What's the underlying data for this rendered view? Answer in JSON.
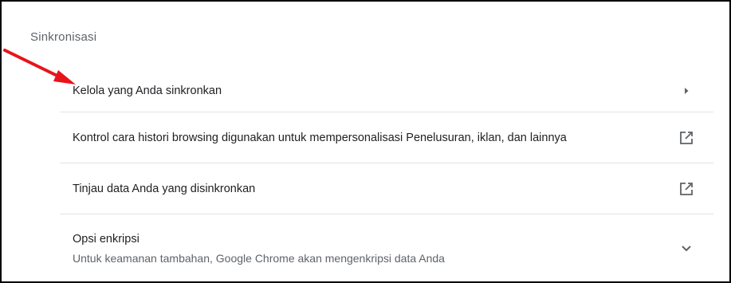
{
  "section": {
    "title": "Sinkronisasi"
  },
  "rows": [
    {
      "label": "Kelola yang Anda sinkronkan",
      "icon": "chevron-right-icon"
    },
    {
      "label": "Kontrol cara histori browsing digunakan untuk mempersonalisasi Penelusuran, iklan, dan lainnya",
      "icon": "open-external-icon"
    },
    {
      "label": "Tinjau data Anda yang disinkronkan",
      "icon": "open-external-icon"
    },
    {
      "label": "Opsi enkripsi",
      "sublabel": "Untuk keamanan tambahan, Google Chrome akan mengenkripsi data Anda",
      "icon": "chevron-down-icon"
    }
  ],
  "colors": {
    "annotation_arrow": "#e8141b",
    "primary_text": "#202124",
    "secondary_text": "#5f6368",
    "icon": "#5f6368"
  }
}
